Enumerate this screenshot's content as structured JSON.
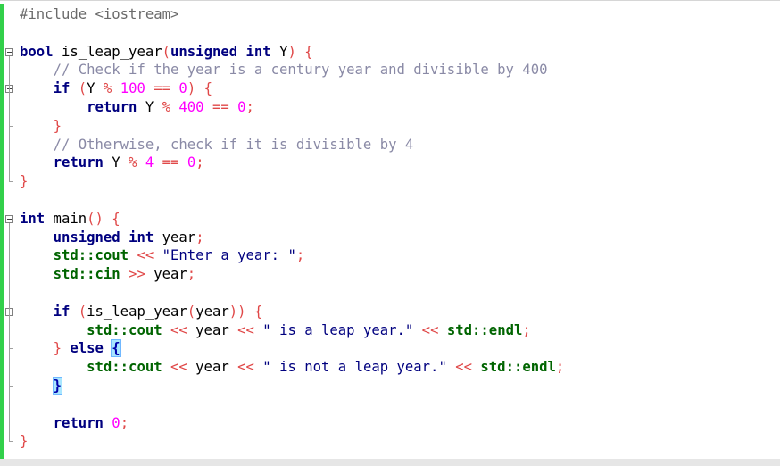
{
  "editor": {
    "lines": [
      [
        {
          "t": "#include <iostream>",
          "c": "pp"
        }
      ],
      [],
      [
        {
          "t": "bool",
          "c": "kw"
        },
        {
          "t": " is_leap_year",
          "c": "id"
        },
        {
          "t": "(",
          "c": "op"
        },
        {
          "t": "unsigned",
          "c": "kw"
        },
        {
          "t": " ",
          "c": "id"
        },
        {
          "t": "int",
          "c": "kw"
        },
        {
          "t": " Y",
          "c": "id"
        },
        {
          "t": ") {",
          "c": "op"
        }
      ],
      [
        {
          "t": "    ",
          "c": "id"
        },
        {
          "t": "// Check if the year is a century year and divisible by 400",
          "c": "cm"
        }
      ],
      [
        {
          "t": "    ",
          "c": "id"
        },
        {
          "t": "if",
          "c": "kw"
        },
        {
          "t": " (",
          "c": "op"
        },
        {
          "t": "Y ",
          "c": "id"
        },
        {
          "t": "% ",
          "c": "op"
        },
        {
          "t": "100",
          "c": "num"
        },
        {
          "t": " == ",
          "c": "op"
        },
        {
          "t": "0",
          "c": "num"
        },
        {
          "t": ") {",
          "c": "op"
        }
      ],
      [
        {
          "t": "        ",
          "c": "id"
        },
        {
          "t": "return",
          "c": "kw"
        },
        {
          "t": " Y ",
          "c": "id"
        },
        {
          "t": "% ",
          "c": "op"
        },
        {
          "t": "400",
          "c": "num"
        },
        {
          "t": " == ",
          "c": "op"
        },
        {
          "t": "0",
          "c": "num"
        },
        {
          "t": ";",
          "c": "op"
        }
      ],
      [
        {
          "t": "    ",
          "c": "id"
        },
        {
          "t": "}",
          "c": "op"
        }
      ],
      [
        {
          "t": "    ",
          "c": "id"
        },
        {
          "t": "// Otherwise, check if it is divisible by 4",
          "c": "cm"
        }
      ],
      [
        {
          "t": "    ",
          "c": "id"
        },
        {
          "t": "return",
          "c": "kw"
        },
        {
          "t": " Y ",
          "c": "id"
        },
        {
          "t": "% ",
          "c": "op"
        },
        {
          "t": "4",
          "c": "num"
        },
        {
          "t": " == ",
          "c": "op"
        },
        {
          "t": "0",
          "c": "num"
        },
        {
          "t": ";",
          "c": "op"
        }
      ],
      [
        {
          "t": "}",
          "c": "op"
        }
      ],
      [],
      [
        {
          "t": "int",
          "c": "kw"
        },
        {
          "t": " main",
          "c": "id"
        },
        {
          "t": "() {",
          "c": "op"
        }
      ],
      [
        {
          "t": "    ",
          "c": "id"
        },
        {
          "t": "unsigned",
          "c": "kw"
        },
        {
          "t": " ",
          "c": "id"
        },
        {
          "t": "int",
          "c": "kw"
        },
        {
          "t": " year",
          "c": "id"
        },
        {
          "t": ";",
          "c": "op"
        }
      ],
      [
        {
          "t": "    ",
          "c": "id"
        },
        {
          "t": "std::cout",
          "c": "std"
        },
        {
          "t": " << ",
          "c": "op"
        },
        {
          "t": "\"Enter a year: \"",
          "c": "str"
        },
        {
          "t": ";",
          "c": "op"
        }
      ],
      [
        {
          "t": "    ",
          "c": "id"
        },
        {
          "t": "std::cin",
          "c": "std"
        },
        {
          "t": " >> ",
          "c": "op"
        },
        {
          "t": "year",
          "c": "id"
        },
        {
          "t": ";",
          "c": "op"
        }
      ],
      [],
      [
        {
          "t": "    ",
          "c": "id"
        },
        {
          "t": "if",
          "c": "kw"
        },
        {
          "t": " (",
          "c": "op"
        },
        {
          "t": "is_leap_year",
          "c": "id"
        },
        {
          "t": "(",
          "c": "op"
        },
        {
          "t": "year",
          "c": "id"
        },
        {
          "t": ")) {",
          "c": "op"
        }
      ],
      [
        {
          "t": "        ",
          "c": "id"
        },
        {
          "t": "std::cout",
          "c": "std"
        },
        {
          "t": " << ",
          "c": "op"
        },
        {
          "t": "year",
          "c": "id"
        },
        {
          "t": " << ",
          "c": "op"
        },
        {
          "t": "\" is a leap year.\"",
          "c": "str"
        },
        {
          "t": " << ",
          "c": "op"
        },
        {
          "t": "std::endl",
          "c": "std"
        },
        {
          "t": ";",
          "c": "op"
        }
      ],
      [
        {
          "t": "    ",
          "c": "id"
        },
        {
          "t": "} ",
          "c": "op"
        },
        {
          "t": "else",
          "c": "kw"
        },
        {
          "t": " ",
          "c": "id"
        },
        {
          "t": "{",
          "c": "brace-match"
        }
      ],
      [
        {
          "t": "        ",
          "c": "id"
        },
        {
          "t": "std::cout",
          "c": "std"
        },
        {
          "t": " << ",
          "c": "op"
        },
        {
          "t": "year",
          "c": "id"
        },
        {
          "t": " << ",
          "c": "op"
        },
        {
          "t": "\" is not a leap year.\"",
          "c": "str"
        },
        {
          "t": " << ",
          "c": "op"
        },
        {
          "t": "std::endl",
          "c": "std"
        },
        {
          "t": ";",
          "c": "op"
        }
      ],
      [
        {
          "t": "    ",
          "c": "id"
        },
        {
          "t": "}",
          "c": "brace-match"
        }
      ],
      [],
      [
        {
          "t": "    ",
          "c": "id"
        },
        {
          "t": "return",
          "c": "kw"
        },
        {
          "t": " ",
          "c": "id"
        },
        {
          "t": "0",
          "c": "num"
        },
        {
          "t": ";",
          "c": "op"
        }
      ],
      [
        {
          "t": "}",
          "c": "op"
        }
      ]
    ],
    "colors": {
      "change_bar": "#32d04a",
      "keyword": "#00007f",
      "comment": "#8a8aa6",
      "number": "#ff00ff",
      "operator": "#e04848",
      "std": "#006400",
      "brace_match_bg": "#a8e6ff"
    },
    "fold_markers": [
      {
        "line": 2,
        "kind": "open"
      },
      {
        "line": 4,
        "kind": "open"
      },
      {
        "line": 11,
        "kind": "open"
      },
      {
        "line": 16,
        "kind": "open"
      }
    ]
  }
}
